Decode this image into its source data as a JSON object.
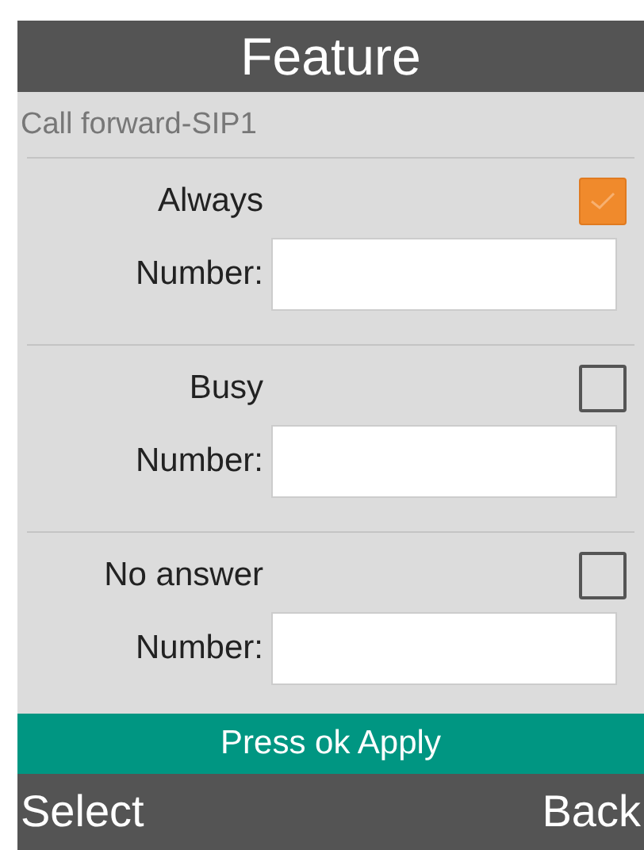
{
  "title": "Feature",
  "subtitle": "Call forward-SIP1",
  "options": [
    {
      "label": "Always",
      "checked": true,
      "field_label": "Number:"
    },
    {
      "label": "Busy",
      "checked": false,
      "field_label": "Number:"
    },
    {
      "label": "No answer",
      "checked": false,
      "field_label": "Number:"
    }
  ],
  "hint": "Press ok Apply",
  "softkeys": {
    "left": "Select",
    "right": "Back"
  }
}
